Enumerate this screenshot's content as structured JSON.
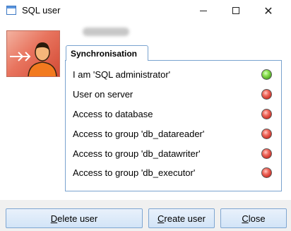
{
  "window": {
    "title": "SQL user",
    "username": "",
    "icons": {
      "app": "window-icon",
      "minimize": "minimize-icon",
      "maximize": "maximize-icon",
      "close": "close-icon",
      "avatar": "user-sync-icon"
    }
  },
  "tab": {
    "label": "Synchronisation"
  },
  "statuses": [
    {
      "label": "I am 'SQL administrator'",
      "status": "green"
    },
    {
      "label": "User on server",
      "status": "red"
    },
    {
      "label": "Access to database",
      "status": "red"
    },
    {
      "label": "Access to group 'db_datareader'",
      "status": "red"
    },
    {
      "label": "Access to group 'db_datawriter'",
      "status": "red"
    },
    {
      "label": "Access to group 'db_executor'",
      "status": "red"
    }
  ],
  "buttons": {
    "delete": {
      "mnemonic": "D",
      "rest": "elete user"
    },
    "create": {
      "mnemonic": "C",
      "rest": "reate user"
    },
    "close": {
      "mnemonic": "C",
      "rest": "lose"
    }
  },
  "colors": {
    "accent": "#7aa3cf",
    "ok": "#4ea524",
    "error": "#cc2f26"
  }
}
